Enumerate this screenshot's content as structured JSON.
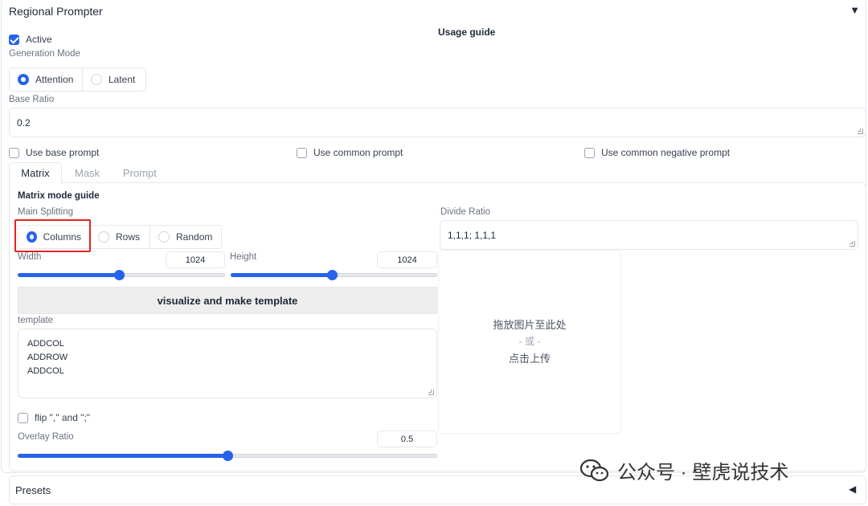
{
  "header": {
    "title": "Regional Prompter",
    "collapse_glyph": "▼"
  },
  "active": {
    "label": "Active",
    "checked": true
  },
  "usage_guide": "Usage guide",
  "generation_mode": {
    "label": "Generation Mode",
    "options": [
      "Attention",
      "Latent"
    ],
    "selected": "Attention"
  },
  "base_ratio": {
    "label": "Base Ratio",
    "value": "0.2"
  },
  "prompt_options": {
    "use_base_prompt": "Use base prompt",
    "use_common_prompt": "Use common prompt",
    "use_common_negative_prompt": "Use common negative prompt"
  },
  "tabs": [
    "Matrix",
    "Mask",
    "Prompt"
  ],
  "active_tab": "Matrix",
  "matrix": {
    "guide_title": "Matrix mode guide",
    "main_splitting": {
      "label": "Main Splitting",
      "options": [
        "Columns",
        "Rows",
        "Random"
      ],
      "selected": "Columns"
    },
    "width": {
      "label": "Width",
      "value": "1024",
      "fraction": 0.49
    },
    "height": {
      "label": "Height",
      "value": "1024",
      "fraction": 0.49
    },
    "visualize_button": "visualize and make template",
    "template": {
      "label": "template",
      "lines": [
        "ADDCOL",
        "ADDROW",
        "ADDCOL"
      ]
    },
    "flip": {
      "label": "flip \",\" and \";\"",
      "checked": false
    },
    "overlay_ratio": {
      "label": "Overlay Ratio",
      "value": "0.5",
      "fraction": 0.5
    },
    "divide_ratio": {
      "label": "Divide Ratio",
      "value": "1,1,1; 1,1,1"
    },
    "upload": {
      "line1": "拖放图片至此处",
      "line2": "- 或 -",
      "line3": "点击上传"
    }
  },
  "presets": {
    "label": "Presets",
    "collapse_glyph": "◀"
  },
  "watermark": {
    "text": "公众号 · 壁虎说技术"
  },
  "colors": {
    "accent": "#2563eb",
    "highlight": "#e02424"
  }
}
